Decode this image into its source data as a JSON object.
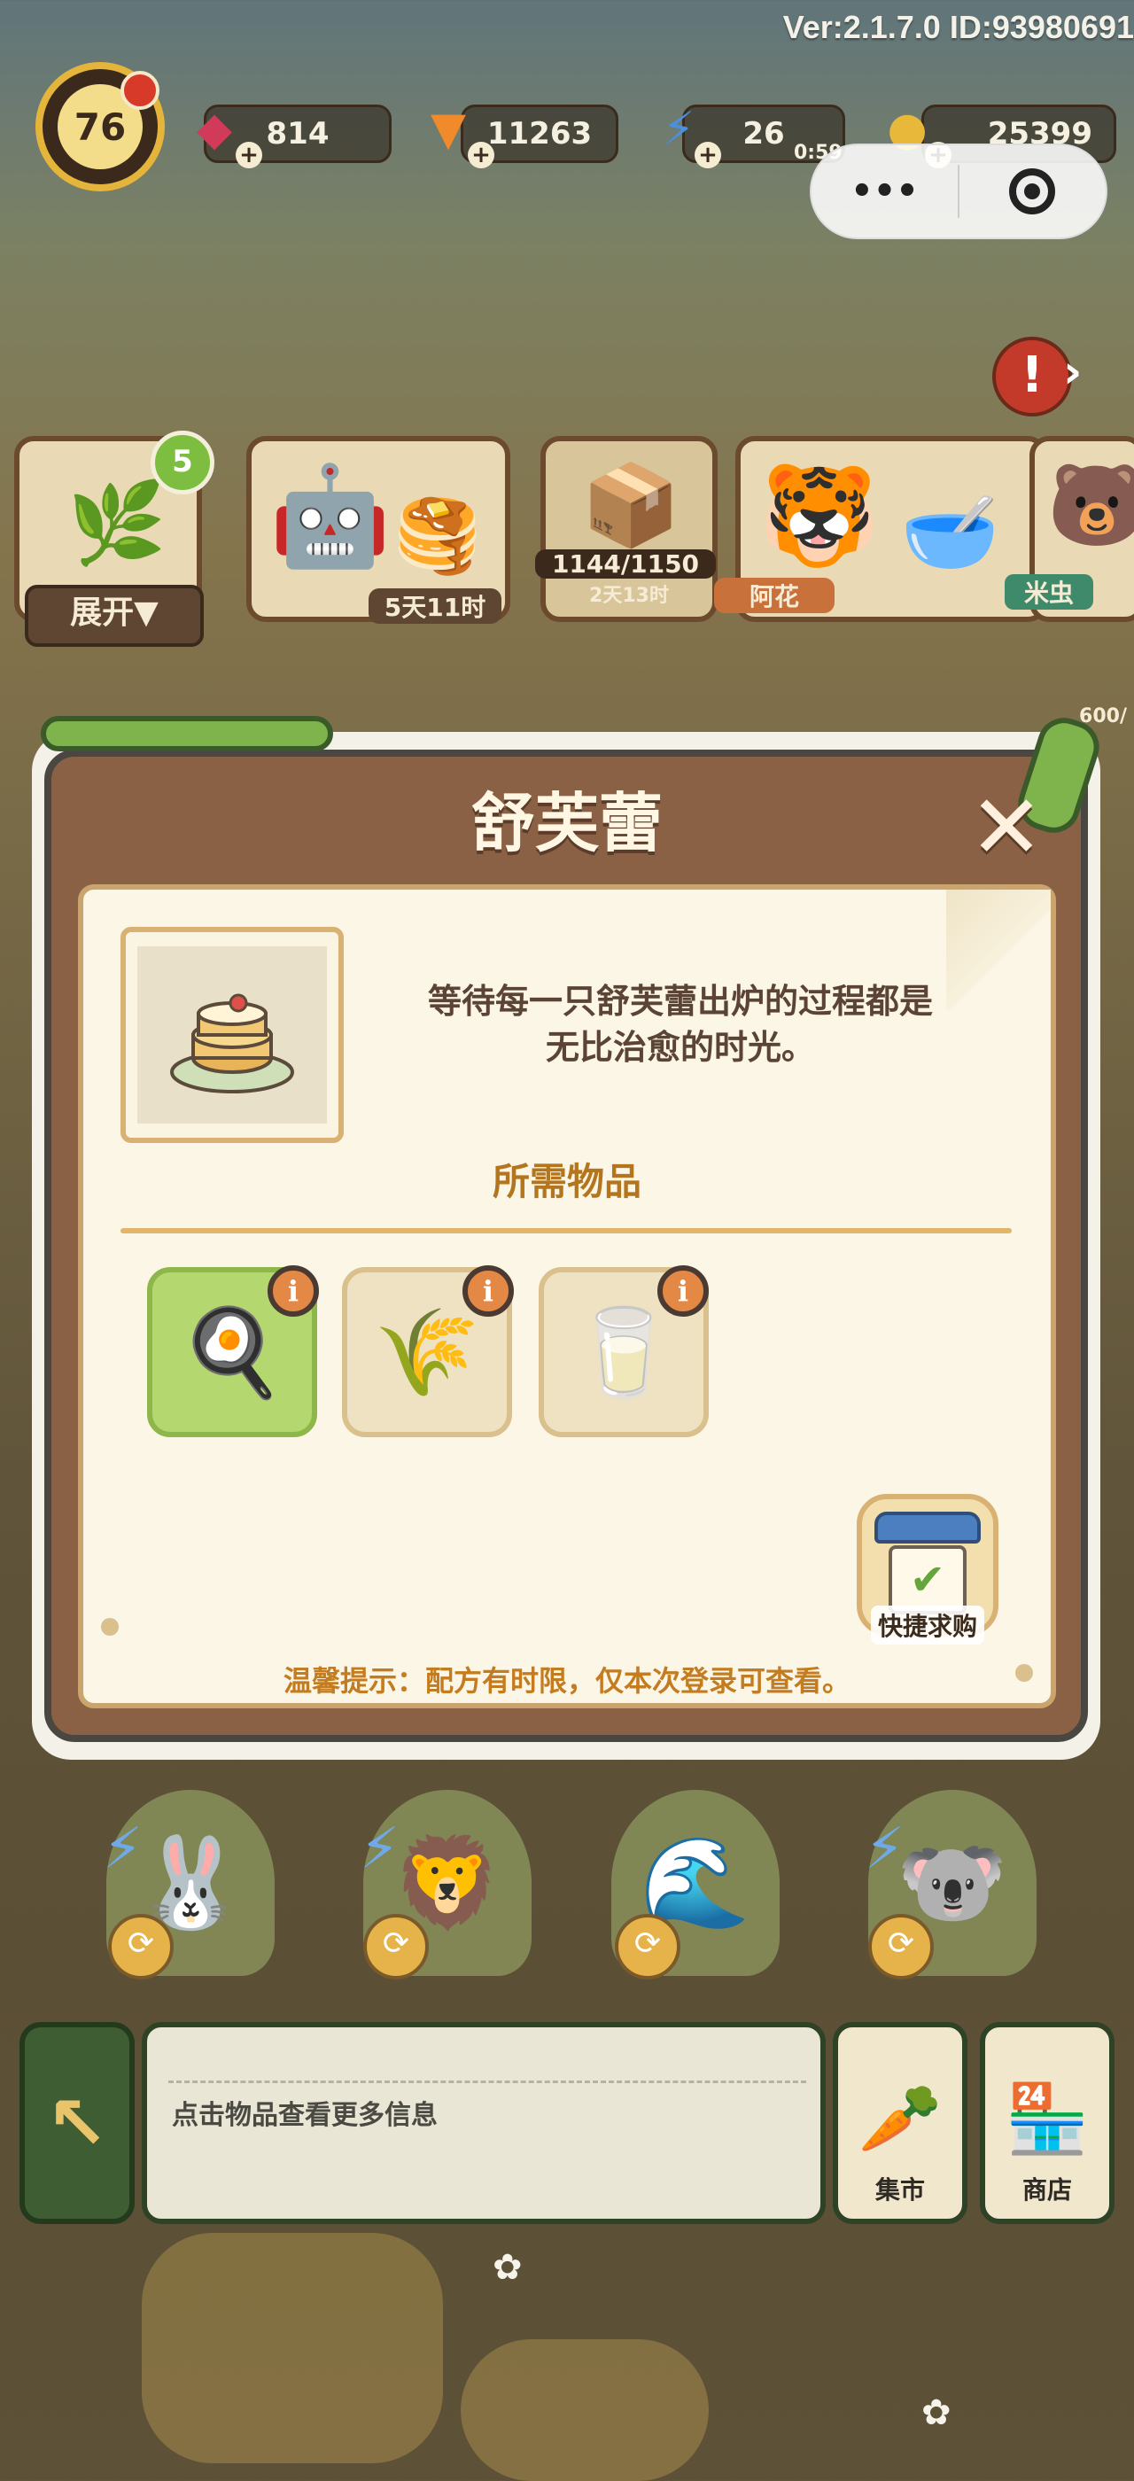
{
  "header": {
    "version": "Ver:2.1.7.0 ID:93980691",
    "level": "76",
    "gems": "814",
    "carrots": "11263",
    "energy": "26",
    "energy_timer": "0:59",
    "coins": "25399"
  },
  "capsule": {
    "more_icon": "more-dots-icon",
    "close_icon": "target-icon"
  },
  "shelf": {
    "count_badge": "5",
    "expand_label": "展开▼",
    "timer_1": "5天11时",
    "progress": "1144/1150",
    "timer_2": "2天13时",
    "npc_1": "阿花",
    "npc_2": "米虫",
    "side_count": "600/"
  },
  "modal": {
    "title": "舒芙蕾",
    "close_icon": "close-icon",
    "description_line1": "等待每一只舒芙蕾出炉的过程都是",
    "description_line2": "无比治愈的时光。",
    "required_title": "所需物品",
    "items": [
      {
        "name": "cookware",
        "icon": "🍳",
        "selected": true
      },
      {
        "name": "flour",
        "icon": "🌾",
        "selected": false
      },
      {
        "name": "milk",
        "icon": "🥛",
        "selected": false
      }
    ],
    "info_glyph": "i",
    "quick_buy_label": "快捷求购",
    "tip": "温馨提示：配方有时限，仅本次登录可查看。"
  },
  "bottom": {
    "info_placeholder": "点击物品查看更多信息",
    "market_label": "集市",
    "shop_label": "商店"
  },
  "colors": {
    "modal_bg": "#8b6145",
    "paper": "#fbf6e6",
    "accent_orange": "#c47c20",
    "selected_green": "#b4d770"
  }
}
